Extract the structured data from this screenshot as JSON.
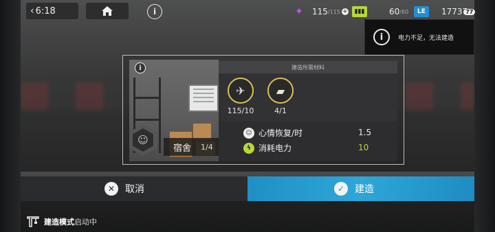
{
  "topbar": {
    "time": "6:18",
    "back_icon": "chevron-left-icon",
    "home_icon": "home-icon",
    "info_label": "i"
  },
  "resources": {
    "drone": {
      "icon": "drone-icon",
      "value": "115",
      "max": "/115",
      "color": "#a33fc7"
    },
    "battery": {
      "icon": "battery-icon",
      "value": "60",
      "max": "/60",
      "color": "#b6d83a"
    },
    "currency": {
      "icon": "lmd-icon",
      "value": "17737",
      "color": "#1f8fd6",
      "badge": "77"
    }
  },
  "notice": {
    "icon_label": "i",
    "text": "电力不足，无法建造"
  },
  "panel": {
    "info_label": "i",
    "materials_header": "建造所需材料",
    "room_name": "宿舍",
    "room_count": "1/4",
    "materials": [
      {
        "icon": "drone-material-icon",
        "count": "115/10"
      },
      {
        "icon": "building-material-icon",
        "count": "4/1"
      }
    ],
    "stats": [
      {
        "icon": "mood-icon",
        "label": "心情恢复/时",
        "value": "1.5"
      },
      {
        "icon": "power-icon",
        "label": "消耗电力",
        "value": "10"
      }
    ]
  },
  "buttons": {
    "cancel_label": "取消",
    "build_label": "建造"
  },
  "status": {
    "mode_strong": "建造模式",
    "mode_weak": "启动中"
  },
  "colors": {
    "build_button": "#2ea6d8",
    "power_value": "#b6d83a",
    "material_ring": "#d8c25a"
  }
}
